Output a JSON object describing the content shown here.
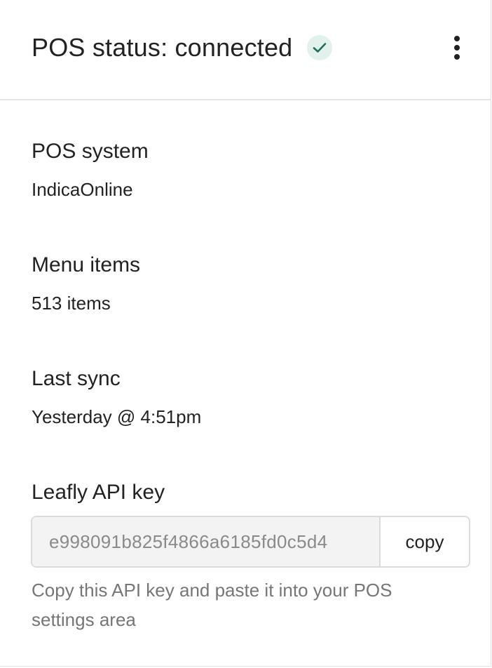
{
  "header": {
    "title": "POS status: connected",
    "status_icon": "check-icon",
    "menu_icon": "kebab-menu-icon"
  },
  "sections": {
    "pos_system": {
      "label": "POS system",
      "value": "IndicaOnline"
    },
    "menu_items": {
      "label": "Menu items",
      "value": "513 items"
    },
    "last_sync": {
      "label": "Last sync",
      "value": "Yesterday @ 4:51pm"
    }
  },
  "api_key": {
    "label": "Leafly API key",
    "value": "e998091b825f4866a6185fd0c5d4",
    "copy_label": "copy",
    "helper": "Copy this API key and paste it into your POS settings area"
  },
  "colors": {
    "status_check_bg": "#e3f1ec",
    "status_check_fg": "#1f6f5c",
    "text": "#222222",
    "muted_text": "#767676"
  }
}
